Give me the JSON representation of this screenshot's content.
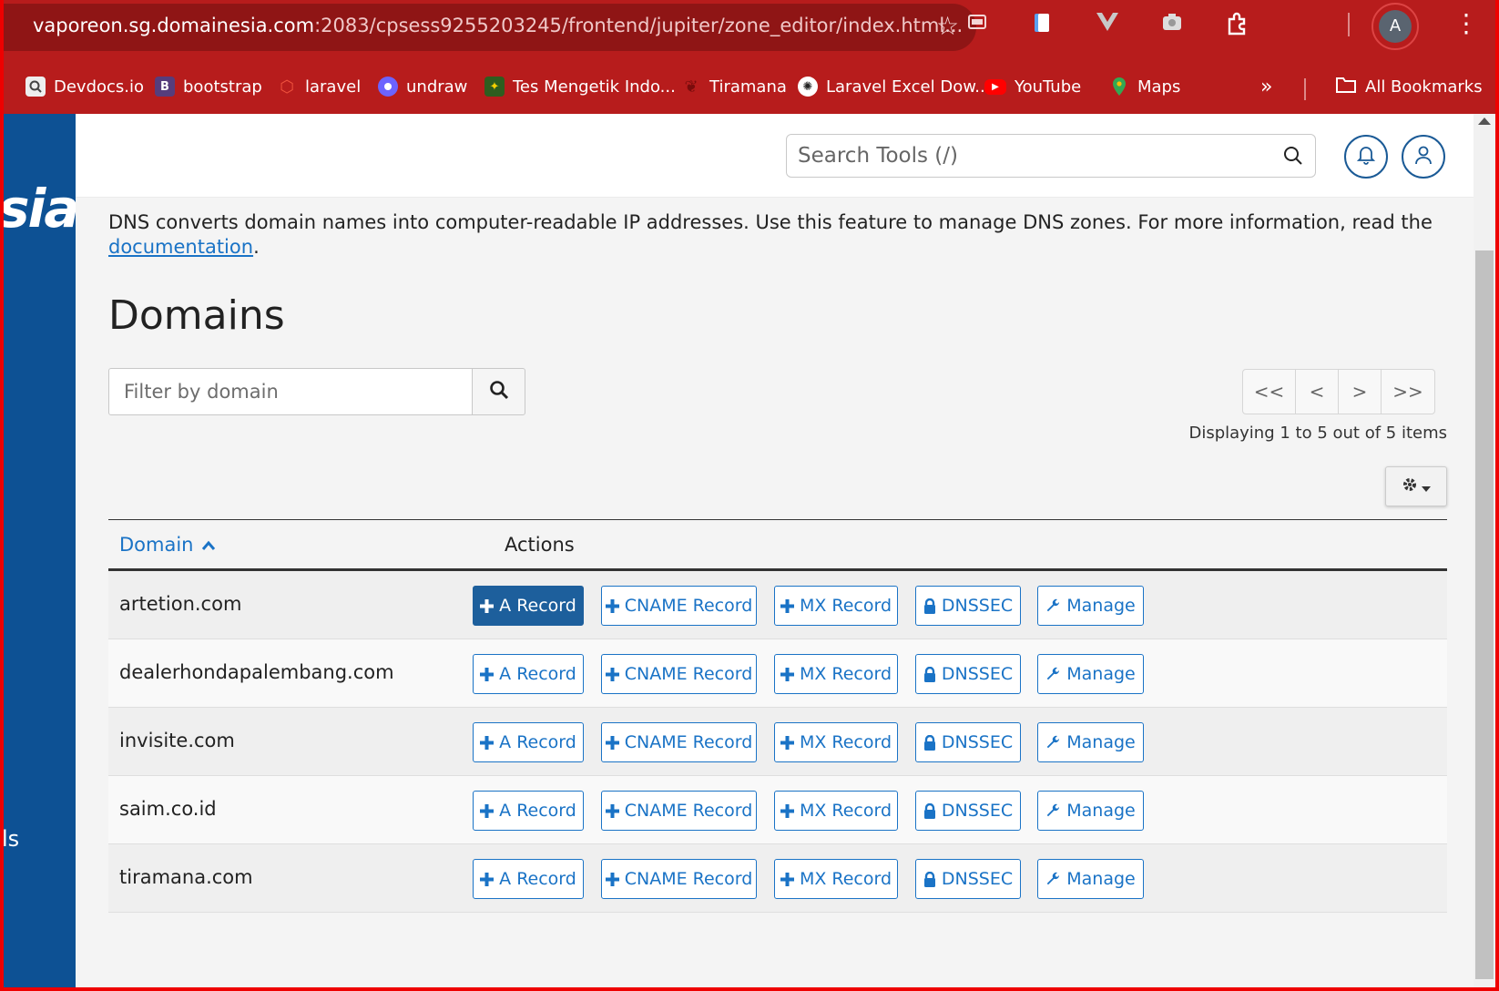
{
  "browser": {
    "url_host": "vaporeon.sg.domainesia.com",
    "url_path": ":2083/cpsess9255203245/frontend/jupiter/zone_editor/index.html...",
    "avatar_letter": "A",
    "bookmarks": [
      {
        "label": "Devdocs.io",
        "icon": "devdocs-icon",
        "color": "#ffffff"
      },
      {
        "label": "bootstrap",
        "icon": "bootstrap-icon",
        "color": "#7b2ff7"
      },
      {
        "label": "laravel",
        "icon": "laravel-icon",
        "color": "#f0533e"
      },
      {
        "label": "undraw",
        "icon": "undraw-icon",
        "color": "#6c63ff"
      },
      {
        "label": "Tes Mengetik Indo...",
        "icon": "tes-mengetik-icon",
        "color": "#2e7d32"
      },
      {
        "label": "Tiramana",
        "icon": "tiramana-icon",
        "color": "#d32f2f"
      },
      {
        "label": "Laravel Excel Dow...",
        "icon": "laravel-excel-icon",
        "color": "#222222"
      },
      {
        "label": "YouTube",
        "icon": "youtube-icon",
        "color": "#ff0000"
      },
      {
        "label": "Maps",
        "icon": "maps-icon",
        "color": "#34a853"
      }
    ],
    "more_label": "»",
    "all_bookmarks": "All Bookmarks"
  },
  "sidebar": {
    "logo_fragment": "sia",
    "tools_fragment": "ls"
  },
  "header": {
    "search_placeholder": "Search Tools (/)"
  },
  "page": {
    "intro_text": "DNS converts domain names into computer-readable IP addresses. Use this feature to manage DNS zones. For more information, read the ",
    "intro_link": "documentation",
    "intro_end": ".",
    "title": "Domains",
    "filter_placeholder": "Filter by domain",
    "pager": [
      "<<",
      "<",
      ">",
      ">>"
    ],
    "display_info": "Displaying 1 to 5 out of 5 items"
  },
  "table": {
    "col_domain": "Domain",
    "col_actions": "Actions",
    "actions": [
      "A Record",
      "CNAME Record",
      "MX Record",
      "DNSSEC",
      "Manage"
    ],
    "rows": [
      "artetion.com",
      "dealerhondapalembang.com",
      "invisite.com",
      "saim.co.id",
      "tiramana.com"
    ]
  },
  "colors": {
    "browser_chrome": "#b71c1c",
    "sidebar": "#0d5194",
    "link": "#1a73c6",
    "primary_button": "#1d5f9c"
  }
}
